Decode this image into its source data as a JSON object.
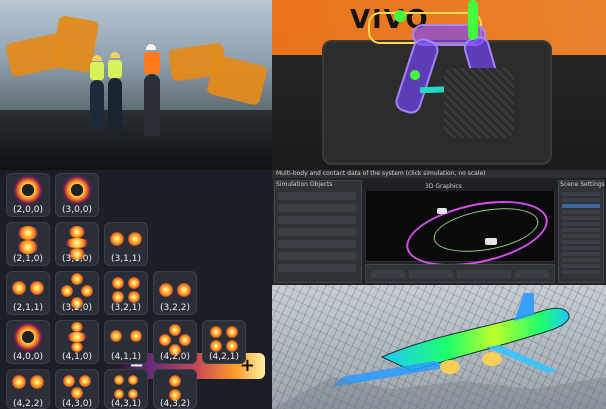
{
  "panels": {
    "factory": {},
    "race_car": {
      "livery_text": "VIVO"
    },
    "modes": {
      "colorbar": {
        "minus": "−",
        "plus": "+"
      },
      "labels": [
        "(2,0,0)",
        "(3,0,0)",
        "(2,1,0)",
        "(3,1,0)",
        "(3,1,1)",
        "(2,1,1)",
        "(3,2,0)",
        "(3,2,1)",
        "(3,2,2)",
        "(4,0,0)",
        "(4,1,0)",
        "(4,1,1)",
        "(4,2,0)",
        "(4,2,1)",
        "(4,2,2)",
        "(4,3,0)",
        "(4,3,1)",
        "(4,3,2)"
      ]
    },
    "software": {
      "window_title": "Multi-body and contact data of the system (click simulation, no scale)",
      "left_panel_title": "Simulation Objects",
      "viewport_tab": "3D Graphics",
      "right_panel_title": "Scene Settings"
    },
    "airplane_cfd": {}
  },
  "colors": {
    "accent_orange": "#ff7a1b",
    "accent_purple": "#6c2d7a",
    "accent_cyan": "#24d6c6",
    "accent_green": "#43ff3e",
    "accent_yellow": "#ffd34e"
  }
}
